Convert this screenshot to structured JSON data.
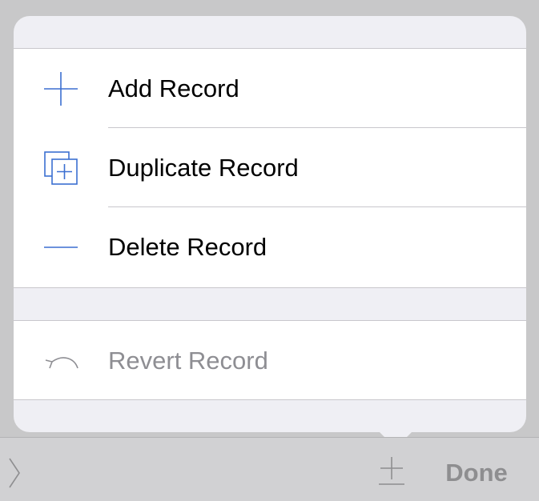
{
  "menu": {
    "items": [
      {
        "label": "Add Record",
        "icon": "plus-icon",
        "enabled": true
      },
      {
        "label": "Duplicate Record",
        "icon": "duplicate-icon",
        "enabled": true
      },
      {
        "label": "Delete Record",
        "icon": "minus-icon",
        "enabled": true
      },
      {
        "label": "Revert Record",
        "icon": "revert-icon",
        "enabled": false
      }
    ]
  },
  "toolbar": {
    "done_label": "Done",
    "left_icon": "chevron-right-icon",
    "add_icon": "add-record-icon"
  },
  "colors": {
    "accent": "#3b6fd1",
    "disabled_text": "#8e8e93",
    "toolbar_text": "#8e8e90",
    "popover_bg": "#efeff4"
  }
}
